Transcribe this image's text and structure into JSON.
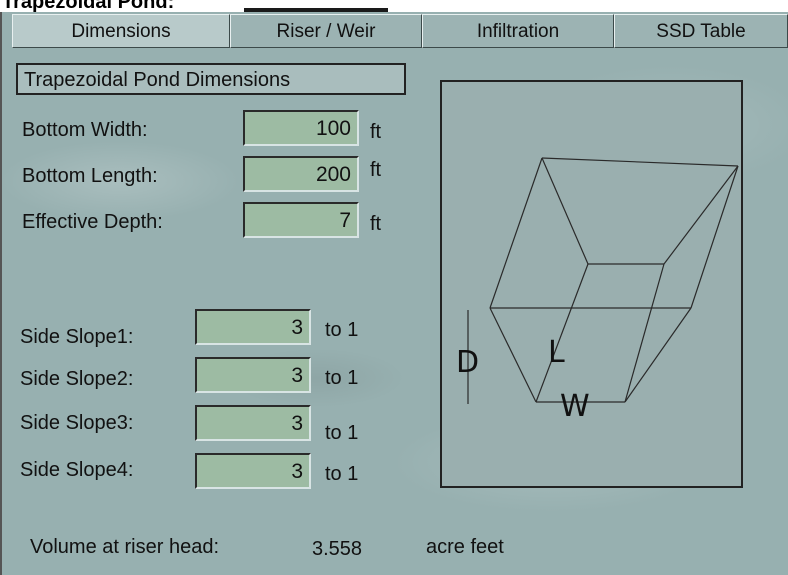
{
  "window": {
    "title": "Trapezoidal Pond:"
  },
  "tabs": [
    {
      "label": "Dimensions",
      "active": true
    },
    {
      "label": "Riser / Weir",
      "active": false
    },
    {
      "label": "Infiltration",
      "active": false
    },
    {
      "label": "SSD Table",
      "active": false
    }
  ],
  "group": {
    "title": "Trapezoidal Pond Dimensions"
  },
  "dimensions": {
    "bottom_width": {
      "label": "Bottom Width:",
      "value": "100",
      "unit": "ft"
    },
    "bottom_length": {
      "label": "Bottom Length:",
      "value": "200",
      "unit": "ft"
    },
    "effective_depth": {
      "label": "Effective Depth:",
      "value": "7",
      "unit": "ft"
    }
  },
  "slopes": [
    {
      "label": "Side Slope1:",
      "value": "3",
      "unit": "to 1"
    },
    {
      "label": "Side Slope2:",
      "value": "3",
      "unit": "to 1"
    },
    {
      "label": "Side Slope3:",
      "value": "3",
      "unit": "to 1"
    },
    {
      "label": "Side Slope4:",
      "value": "3",
      "unit": "to 1"
    }
  ],
  "volume": {
    "label": "Volume at riser head:",
    "value": "3.558",
    "unit": "acre feet"
  },
  "diagram": {
    "depth_label": "D",
    "length_label": "L",
    "width_label": "W"
  },
  "colors": {
    "panel_bg": "#97b0b0",
    "field_bg": "#9dbba3",
    "active_tab": "#b8caca"
  }
}
